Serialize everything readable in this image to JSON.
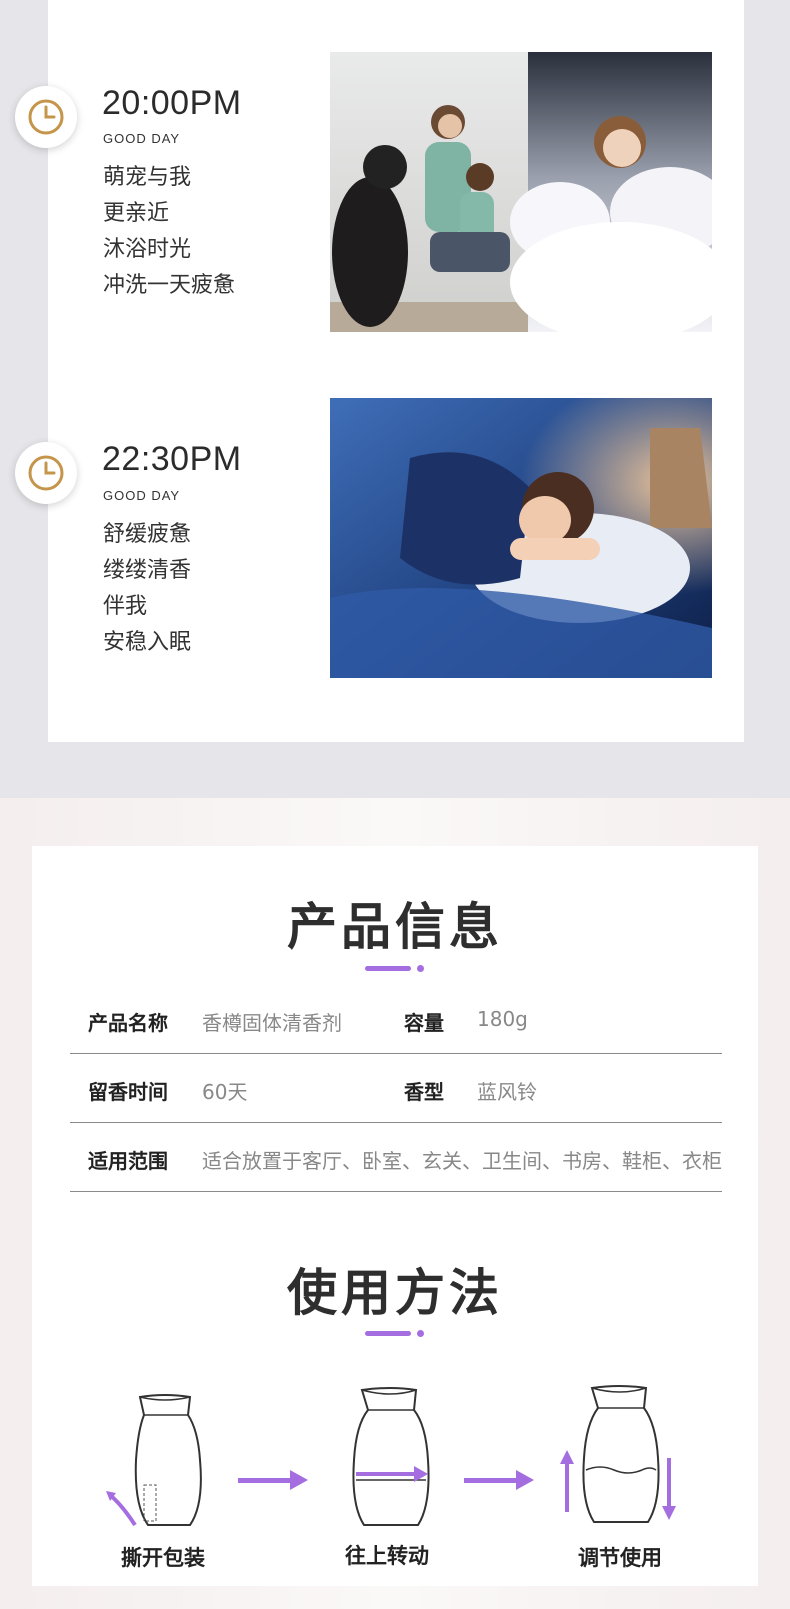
{
  "timeline": [
    {
      "time": "20:00PM",
      "subtitle": "GOOD DAY",
      "lines": [
        "萌宠与我",
        "更亲近",
        "沐浴时光",
        "冲洗一天疲惫"
      ]
    },
    {
      "time": "22:30PM",
      "subtitle": "GOOD DAY",
      "lines": [
        "舒缓疲惫",
        "缕缕清香",
        "伴我",
        "安稳入眠"
      ]
    }
  ],
  "product_info": {
    "title": "产品信息",
    "rows": [
      {
        "label1": "产品名称",
        "value1": "香樽固体清香剂",
        "label2": "容量",
        "value2": "180g"
      },
      {
        "label1": "留香时间",
        "value1": "60天",
        "label2": "香型",
        "value2": "蓝风铃"
      },
      {
        "label1": "适用范围",
        "value1": "适合放置于客厅、卧室、玄关、卫生间、书房、鞋柜、衣柜"
      }
    ]
  },
  "usage": {
    "title": "使用方法",
    "steps": [
      "撕开包装",
      "往上转动",
      "调节使用"
    ]
  },
  "colors": {
    "accent": "#a46ee0",
    "clock": "#c4954a"
  }
}
